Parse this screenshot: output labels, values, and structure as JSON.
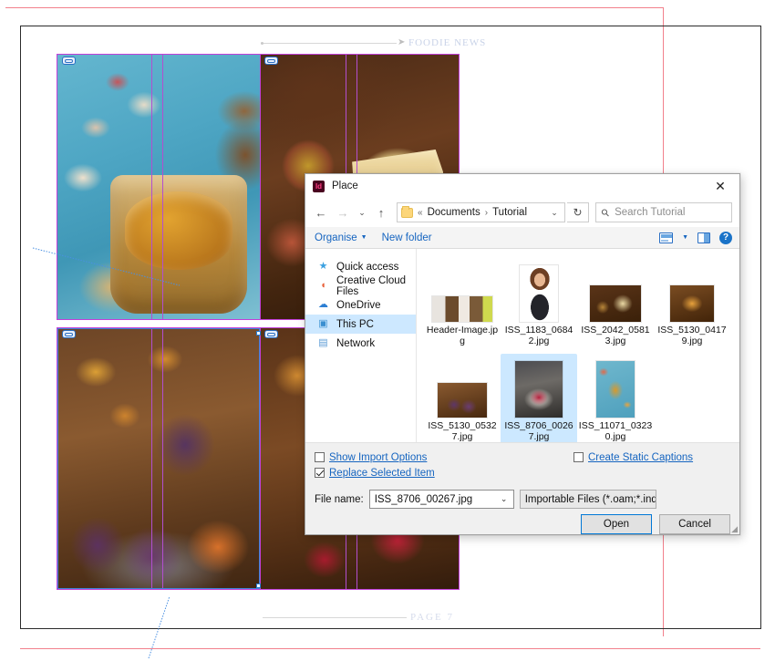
{
  "canvas": {
    "top_label": "FOODIE NEWS",
    "bottom_label": "PAGE 7"
  },
  "dialog": {
    "title": "Place",
    "app_icon": "indesign-icon",
    "app_icon_text": "Id",
    "close_label": "✕",
    "nav": {
      "back": "←",
      "forward": "→",
      "recent": "⌄",
      "up": "↑",
      "breadcrumb_prefix": "«",
      "breadcrumb": [
        "Documents",
        "Tutorial"
      ],
      "breadcrumb_separator": "›",
      "address_caret": "⌄",
      "refresh": "↻",
      "search_placeholder": "Search Tutorial",
      "search_icon": "⚲"
    },
    "commandbar": {
      "organise": "Organise",
      "organise_caret": "▼",
      "new_folder": "New folder",
      "view_caret": "▼",
      "help": "?"
    },
    "sidebar": [
      {
        "label": "Quick access",
        "icon": "★",
        "icon_color": "#3aa0e0",
        "selected": false
      },
      {
        "label": "Creative Cloud Files",
        "icon": "☁",
        "icon_color": "#e8623c",
        "selected": false
      },
      {
        "label": "OneDrive",
        "icon": "☁",
        "icon_color": "#2d7fd3",
        "selected": false
      },
      {
        "label": "This PC",
        "icon": "▣",
        "icon_color": "#3a8fd0",
        "selected": true
      },
      {
        "label": "Network",
        "icon": "▤",
        "icon_color": "#5b9bd5",
        "selected": false
      }
    ],
    "files": [
      {
        "name": "Header-Image.jpg",
        "thumb": "t-header",
        "selected": false
      },
      {
        "name": "ISS_1183_06842.jpg",
        "thumb": "t-woman",
        "selected": false
      },
      {
        "name": "ISS_2042_05813.jpg",
        "thumb": "t-figs-cheese",
        "selected": false
      },
      {
        "name": "ISS_5130_04179.jpg",
        "thumb": "t-soup",
        "selected": false
      },
      {
        "name": "ISS_5130_05327.jpg",
        "thumb": "t-figs-tray",
        "selected": false
      },
      {
        "name": "ISS_8706_00267.jpg",
        "thumb": "t-pie",
        "selected": true
      },
      {
        "name": "ISS_11071_03230.jpg",
        "thumb": "t-jar",
        "selected": false
      }
    ],
    "options": {
      "show_import_options": {
        "label_before": "S",
        "label_accel": "",
        "label": "Show Import Options",
        "checked": false
      },
      "create_static_captions": {
        "label": "Create Static Captions",
        "checked": false
      },
      "replace_selected_item": {
        "label": "Replace Selected Item",
        "checked": true
      }
    },
    "filename": {
      "label": "File name:",
      "value": "ISS_8706_00267.jpg",
      "caret": "⌄"
    },
    "filter": {
      "value": "Importable Files (*.oam;*.inds;*",
      "caret": "⌄"
    },
    "buttons": {
      "open": "Open",
      "cancel": "Cancel"
    }
  },
  "colors": {
    "accent": "#0078d7",
    "selection": "#cce8ff",
    "link_text": "#1665c0",
    "guide_magenta": "#b24fd0",
    "bleed_red": "#f2808c",
    "handle_blue": "#2a7fd4"
  }
}
